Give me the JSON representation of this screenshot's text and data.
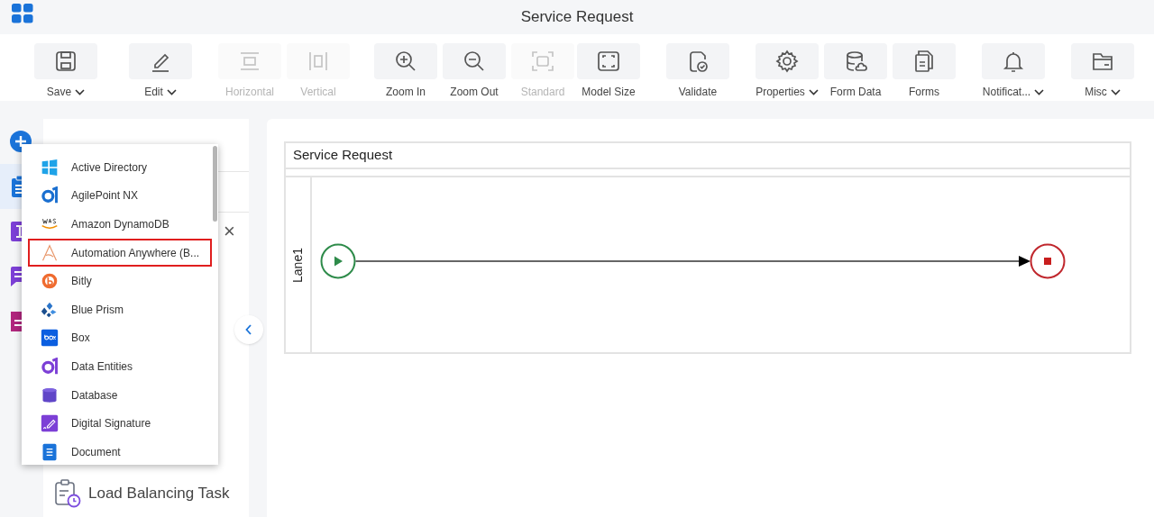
{
  "header": {
    "title": "Service Request"
  },
  "toolbar": [
    {
      "label": "Save",
      "has_menu": true,
      "disabled": false
    },
    {
      "label": "Edit",
      "has_menu": true,
      "disabled": false
    },
    {
      "label": "Horizontal",
      "has_menu": false,
      "disabled": true
    },
    {
      "label": "Vertical",
      "has_menu": false,
      "disabled": true
    },
    {
      "label": "Zoom In",
      "has_menu": false,
      "disabled": false
    },
    {
      "label": "Zoom Out",
      "has_menu": false,
      "disabled": false
    },
    {
      "label": "Standard",
      "has_menu": false,
      "disabled": true
    },
    {
      "label": "Model Size",
      "has_menu": false,
      "disabled": false
    },
    {
      "label": "Validate",
      "has_menu": false,
      "disabled": false
    },
    {
      "label": "Properties",
      "has_menu": true,
      "disabled": false
    },
    {
      "label": "Form Data",
      "has_menu": false,
      "disabled": false
    },
    {
      "label": "Forms",
      "has_menu": false,
      "disabled": false
    },
    {
      "label": "Notificat...",
      "has_menu": true,
      "disabled": false
    },
    {
      "label": "Misc",
      "has_menu": true,
      "disabled": false
    }
  ],
  "rail": [
    {
      "selected": false
    },
    {
      "selected": true
    },
    {
      "selected": false
    },
    {
      "selected": false
    },
    {
      "selected": false
    }
  ],
  "library": {
    "close": "×",
    "task": "Load Balancing Task"
  },
  "dropdown": [
    {
      "label": "Active Directory",
      "selected": false
    },
    {
      "label": "AgilePoint NX",
      "selected": false
    },
    {
      "label": "Amazon DynamoDB",
      "selected": false
    },
    {
      "label": "Automation Anywhere (B...",
      "selected": true
    },
    {
      "label": "Bitly",
      "selected": false
    },
    {
      "label": "Blue Prism",
      "selected": false
    },
    {
      "label": "Box",
      "selected": false
    },
    {
      "label": "Data Entities",
      "selected": false
    },
    {
      "label": "Database",
      "selected": false
    },
    {
      "label": "Digital Signature",
      "selected": false
    },
    {
      "label": "Document",
      "selected": false
    }
  ],
  "canvas": {
    "pool": "Service Request",
    "lane": "Lane1"
  }
}
